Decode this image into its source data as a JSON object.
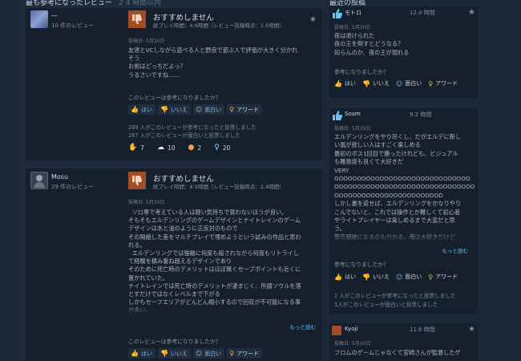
{
  "left_title": "最も参考になったレビュー",
  "left_title_sub": "2 4 時間以内",
  "right_title": "最近の投稿",
  "review1": {
    "user": "—",
    "review_count": "10 件のレビュー",
    "verdict": "おすすめしません",
    "playtime": "総プレイ時間：4.6時間（レビュー投稿時点：1.5時間）",
    "posted": "投稿日: 5月30日",
    "body": "友達とVCしながら遊べる人と野良で遊ぶ人で評価が大きく分かれ\nそう\nお前はどっちだよっ？\nうるさいですね……",
    "helpful_q": "このレビューは参考になりましたか？",
    "yes": "はい",
    "no": "いいえ",
    "funny": "面白い",
    "award": "アワード",
    "stat1": "289 人がこのレビューが参考になったと投票しました",
    "stat2": "267 人がこのレビューが面白いと投票しました",
    "awards": [
      "7",
      "10",
      "2",
      "20"
    ]
  },
  "review2": {
    "user": "Mosu",
    "review_count": "29 件のレビュー",
    "verdict": "おすすめしません",
    "playtime": "総プレイ時間：8.5時間（レビュー投稿時点：2.4時間）",
    "posted": "投稿日: 5月30日",
    "body": "  ソロ専で考えている人は軽い気持ちで買わないほうが良い。\nそもそもエルデンリングのゲームデザインとナイトレインのゲーム\nデザインは水と油のように正反対のもので\nその隔絶した差をマルチプレイで埋めようという試みの作品と思わ\nれる。\n  エルデンリングでは強敵に何度も殺されながら何度もリトライし\nて経験を積み重ね越えるデザインであり\nそのために死亡時のデメリットはほぼ無くセーブポイントも近くに\n置かれていた。\nナイトレインでは死亡時のデメリットが凄まじく、所謂ソウルを落\nとすだけではなくレベルまで下がる\nしかもセーフエリアがどんどん縮小するので回収が不可能になる事\nが多い。",
    "readmore": "もっと読む",
    "helpful_q": "このレビューは参考になりましたか？",
    "yes": "はい",
    "no": "いいえ",
    "funny": "面白い",
    "award": "アワード"
  },
  "recent1": {
    "user": "モトロ",
    "hours": "12.4 時間",
    "posted": "投稿日: 5月30日",
    "body": "夜は退けられた\n夜の王を倒すとどうなる？\n知らんのか、夜の王が現れる",
    "helpful_q": "参考になりましたか？",
    "yes": "はい",
    "no": "いいえ",
    "funny": "面白い",
    "award": "アワード"
  },
  "recent2": {
    "user": "Soam",
    "hours": "9.2 時間",
    "posted": "投稿日: 5月30日",
    "body": "エルデンリングをやり尽くし、だがエルデに新し\nい風が欲しい人はすごく楽しめる\n最初のボス1回目で勝ったけれども、ビジュアル\nも難易度も良くて大好きだ\nVERY\nGOOOOOOOOOOOOOOOOOOOOOOOOOOOOO\nOOOOOOOOOOOOOOOOOOOOOOOOOOOOOOO\nOOOOOOOOOOOOOOOOOOOOOOOD\nしかし裏を返せば、エルデンリングをかなりやり\nこんでないと、これでは操作とか難しくて初心者\nやライトプレイヤーは楽しめるまで大変だと思\nう。\n警告踏破になるのも分かる。俺は大好きだけど",
    "readmore": "もっと読む",
    "helpful_q": "参考になりましたか？",
    "yes": "はい",
    "no": "いいえ",
    "funny": "面白い",
    "award": "アワード",
    "stat1": "2 人がこのレビューが参考になったと投票しました",
    "stat2": "1人がこのレビューが面白いと投票しました"
  },
  "recent3": {
    "user": "Kyoji",
    "hours": "11.6 時間",
    "posted": "投稿日: 5月30日",
    "body": "フロムのゲームじゃなくて宮崎さんが監督したゲ"
  }
}
